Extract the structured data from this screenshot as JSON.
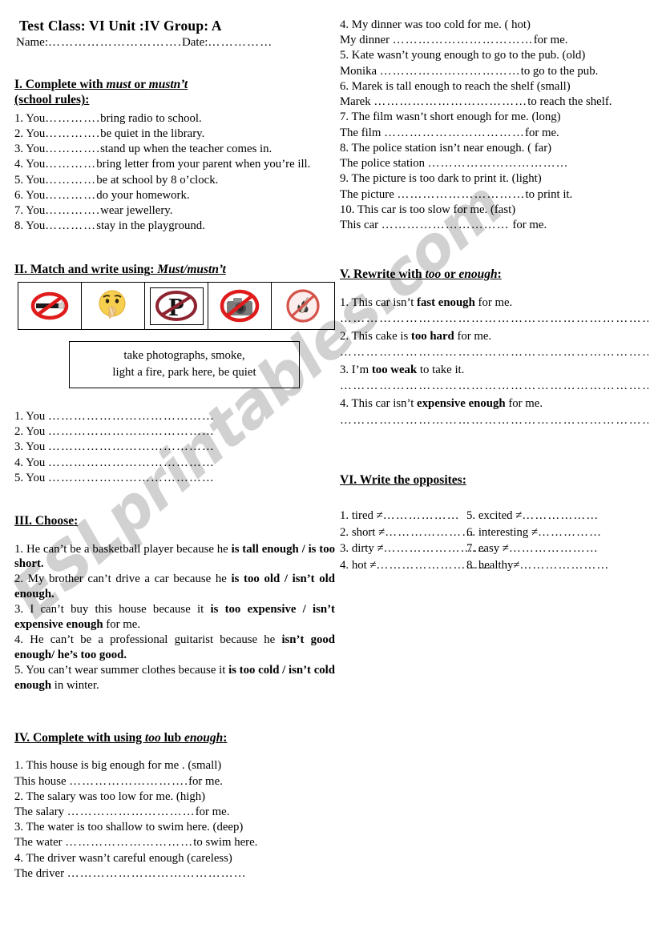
{
  "watermark": {
    "text": "ESLprintables.com"
  },
  "header": {
    "title": "Test  Class: VI  Unit :IV   Group: A",
    "name_label": "Name:",
    "name_dots": "………………………….",
    "date_label": "Date:",
    "date_dots": "……………"
  },
  "exercise1": {
    "heading_pre": "I. Complete with ",
    "heading_ital1": "must",
    "heading_mid": " or ",
    "heading_ital2": "mustn’t",
    "heading_line2": "(school rules):",
    "items": [
      {
        "num": "1.",
        "subject": "You",
        "dots": "………….",
        "rest": "bring radio to school."
      },
      {
        "num": "2.",
        "subject": "You",
        "dots": "………….",
        "rest": "be quiet in the library."
      },
      {
        "num": "3.",
        "subject": "You",
        "dots": "………….",
        "rest": "stand up when the teacher comes in."
      },
      {
        "num": "4.",
        "subject": "You",
        "dots": "…………",
        "rest": "bring letter from your parent when you’re ill."
      },
      {
        "num": "5.",
        "subject": "You",
        "dots": "…………",
        "rest": "be at school by 8 o’clock."
      },
      {
        "num": "6.",
        "subject": "You",
        "dots": "…………",
        "rest": "do your homework."
      },
      {
        "num": "7.",
        "subject": "You",
        "dots": "………….",
        "rest": "wear jewellery."
      },
      {
        "num": "8.",
        "subject": "You",
        "dots": "…………",
        "rest": "stay in the playground."
      }
    ]
  },
  "exercise2": {
    "heading_pre": "II. Match and write using",
    "heading_colon": ": ",
    "heading_ital": "Must/mustn’t",
    "icons": [
      {
        "name": "no-smoking-icon",
        "alt": "no smoking"
      },
      {
        "name": "shushing-face-icon",
        "alt": "be quiet"
      },
      {
        "name": "no-parking-icon",
        "alt": "no parking"
      },
      {
        "name": "no-camera-icon",
        "alt": "no photographs"
      },
      {
        "name": "no-fire-icon",
        "alt": "no fire"
      }
    ],
    "wordbank_line1": "take photographs,     smoke,",
    "wordbank_line2": "light a fire,  park here,  be quiet",
    "answers": [
      {
        "num": "1.",
        "subject": "You",
        "dots": "…………………………………"
      },
      {
        "num": "2.",
        "subject": "You",
        "dots": "…………………………………"
      },
      {
        "num": "3.",
        "subject": "You",
        "dots": "…………………………………"
      },
      {
        "num": "4.",
        "subject": "You",
        "dots": "…………………………………"
      },
      {
        "num": "5.",
        "subject": "You",
        "dots": "…………………………………"
      }
    ]
  },
  "exercise3": {
    "heading": "III. Choose:",
    "items": [
      {
        "plain1": "1. He can’t be a basketball player because he ",
        "bold1": "is tall enough / is too short.",
        "plain2": ""
      },
      {
        "plain1": "2. My brother can’t drive a car because he ",
        "bold1": "is too old / isn’t old enough.",
        "plain2": ""
      },
      {
        "plain1": "3. I can’t buy this house because it ",
        "bold1": "is too expensive / isn’t expensive enough",
        "plain2": " for me."
      },
      {
        "plain1": "4. He can’t be a professional guitarist because he ",
        "bold1": "isn’t good enough/ he’s too good.",
        "plain2": ""
      },
      {
        "plain1": "5. You can’t wear summer clothes because it ",
        "bold1": "is too cold / isn’t cold enough",
        "plain2": " in winter."
      }
    ]
  },
  "exercise4": {
    "heading_pre": "IV. Complete with using ",
    "heading_ital1": "too",
    "heading_mid": " lub ",
    "heading_ital2": "enough",
    "heading_colon": ":",
    "items": [
      {
        "prompt": "1.   This house is big enough for me . (small)",
        "answer_pre": "This house  ",
        "dots": "……………………….",
        "answer_post": "for me."
      },
      {
        "prompt": "2.   The salary was too low for me. (high)",
        "answer_pre": "The salary  ",
        "dots": "…………………………",
        "answer_post": "for me."
      },
      {
        "prompt": "3.   The water is too shallow to swim here. (deep)",
        "answer_pre": "The water ",
        "dots": "…………………………",
        "answer_post": "to swim here."
      },
      {
        "prompt": " 4. The driver wasn’t careful enough (careless)",
        "answer_pre": " The driver  ",
        "dots": "……………………………………",
        "answer_post": ""
      },
      {
        "prompt": "4.   My dinner was too cold for me. ( hot)",
        "answer_pre": "My dinner ",
        "dots": "……………………………",
        "answer_post": "for me."
      },
      {
        "prompt": "5.   Kate wasn’t young enough to go to the pub. (old)",
        "answer_pre": "Monika ",
        "dots": "……………………………",
        "answer_post": "to go to the pub."
      },
      {
        "prompt": "6.   Marek is tall enough to reach the shelf (small)",
        "answer_pre": "Marek ",
        "dots": "………………………………",
        "answer_post": "to reach the shelf."
      },
      {
        "prompt": "7. The film wasn’t short enough for me. (long)",
        "answer_pre": "The film ",
        "dots": "……………………………",
        "answer_post": "for me."
      },
      {
        "prompt": "8. The police station isn’t near enough. ( far)",
        "answer_pre": "The police station ",
        "dots": "……………………………",
        "answer_post": ""
      },
      {
        "prompt": "9. The picture is too dark to print it. (light)",
        "answer_pre": "The picture ",
        "dots": "…………………………",
        "answer_post": "to print it."
      },
      {
        "prompt": "10. This car is too slow for me. (fast)",
        "answer_pre": "This car ",
        "dots": "…………………………",
        "answer_post": " for me."
      }
    ]
  },
  "exercise5": {
    "heading_pre": "V. Rewrite with ",
    "heading_ital1": "too",
    "heading_mid": " or ",
    "heading_ital2": "enough",
    "heading_colon": ":",
    "rule": "………………………………………………………………………",
    "items": [
      {
        "plain1": " 1. This car isn’t ",
        "bold": "fast enough",
        "plain2": " for me."
      },
      {
        "plain1": "2. This cake is ",
        "bold": "too hard",
        "plain2": " for me."
      },
      {
        "plain1": "3. I’m ",
        "bold": "too weak",
        "plain2": " to take it."
      },
      {
        "plain1": "4. This car isn’t ",
        "bold": "expensive enough",
        "plain2": " for me."
      }
    ]
  },
  "exercise6": {
    "heading": "VI. Write the opposites:",
    "items": [
      {
        "num": "1.",
        "word": "tired ≠",
        "dots": "………………"
      },
      {
        "num": "5.",
        "word": "excited ≠",
        "dots": "………………"
      },
      {
        "num": "2.",
        "word": "short ≠",
        "dots": "…………………"
      },
      {
        "num": "6.",
        "word": "interesting ≠",
        "dots": "……………"
      },
      {
        "num": "3.",
        "word": "dirty ≠",
        "dots": "……………………"
      },
      {
        "num": "7.",
        "word": "easy ≠",
        "dots": "…………………"
      },
      {
        "num": "4.",
        "word": "hot ≠",
        "dots": "………………………"
      },
      {
        "num": "8.",
        "word": "healthy≠",
        "dots": "…………………"
      }
    ]
  },
  "colors": {
    "prohibition_red": "#e01b1b",
    "fire_sign_red": "#d4534a",
    "parking_maroon": "#8e2430",
    "emoji_yellow": "#f7cf4e",
    "camera_gray": "#6e6e6e"
  }
}
